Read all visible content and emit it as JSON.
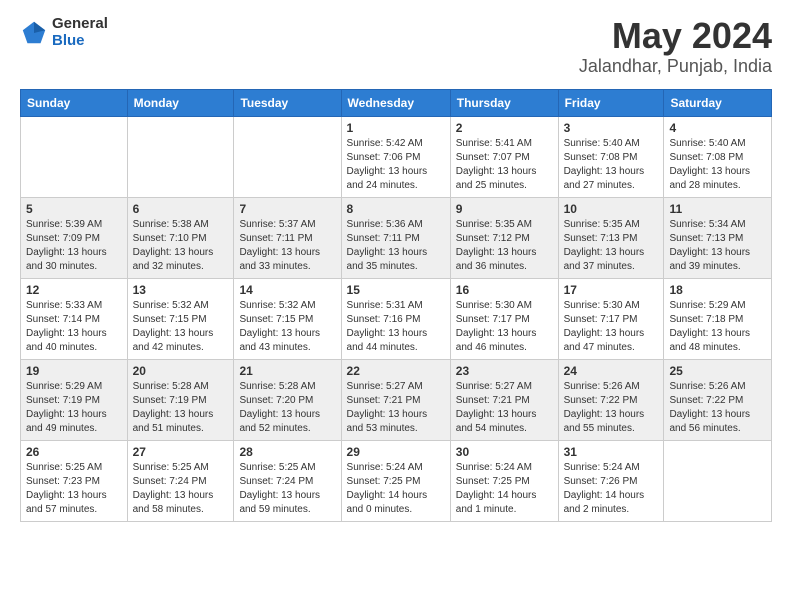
{
  "logo": {
    "general": "General",
    "blue": "Blue"
  },
  "title": "May 2024",
  "subtitle": "Jalandhar, Punjab, India",
  "days_of_week": [
    "Sunday",
    "Monday",
    "Tuesday",
    "Wednesday",
    "Thursday",
    "Friday",
    "Saturday"
  ],
  "weeks": [
    [
      {
        "day": "",
        "info": ""
      },
      {
        "day": "",
        "info": ""
      },
      {
        "day": "",
        "info": ""
      },
      {
        "day": "1",
        "info": "Sunrise: 5:42 AM\nSunset: 7:06 PM\nDaylight: 13 hours\nand 24 minutes."
      },
      {
        "day": "2",
        "info": "Sunrise: 5:41 AM\nSunset: 7:07 PM\nDaylight: 13 hours\nand 25 minutes."
      },
      {
        "day": "3",
        "info": "Sunrise: 5:40 AM\nSunset: 7:08 PM\nDaylight: 13 hours\nand 27 minutes."
      },
      {
        "day": "4",
        "info": "Sunrise: 5:40 AM\nSunset: 7:08 PM\nDaylight: 13 hours\nand 28 minutes."
      }
    ],
    [
      {
        "day": "5",
        "info": "Sunrise: 5:39 AM\nSunset: 7:09 PM\nDaylight: 13 hours\nand 30 minutes."
      },
      {
        "day": "6",
        "info": "Sunrise: 5:38 AM\nSunset: 7:10 PM\nDaylight: 13 hours\nand 32 minutes."
      },
      {
        "day": "7",
        "info": "Sunrise: 5:37 AM\nSunset: 7:11 PM\nDaylight: 13 hours\nand 33 minutes."
      },
      {
        "day": "8",
        "info": "Sunrise: 5:36 AM\nSunset: 7:11 PM\nDaylight: 13 hours\nand 35 minutes."
      },
      {
        "day": "9",
        "info": "Sunrise: 5:35 AM\nSunset: 7:12 PM\nDaylight: 13 hours\nand 36 minutes."
      },
      {
        "day": "10",
        "info": "Sunrise: 5:35 AM\nSunset: 7:13 PM\nDaylight: 13 hours\nand 37 minutes."
      },
      {
        "day": "11",
        "info": "Sunrise: 5:34 AM\nSunset: 7:13 PM\nDaylight: 13 hours\nand 39 minutes."
      }
    ],
    [
      {
        "day": "12",
        "info": "Sunrise: 5:33 AM\nSunset: 7:14 PM\nDaylight: 13 hours\nand 40 minutes."
      },
      {
        "day": "13",
        "info": "Sunrise: 5:32 AM\nSunset: 7:15 PM\nDaylight: 13 hours\nand 42 minutes."
      },
      {
        "day": "14",
        "info": "Sunrise: 5:32 AM\nSunset: 7:15 PM\nDaylight: 13 hours\nand 43 minutes."
      },
      {
        "day": "15",
        "info": "Sunrise: 5:31 AM\nSunset: 7:16 PM\nDaylight: 13 hours\nand 44 minutes."
      },
      {
        "day": "16",
        "info": "Sunrise: 5:30 AM\nSunset: 7:17 PM\nDaylight: 13 hours\nand 46 minutes."
      },
      {
        "day": "17",
        "info": "Sunrise: 5:30 AM\nSunset: 7:17 PM\nDaylight: 13 hours\nand 47 minutes."
      },
      {
        "day": "18",
        "info": "Sunrise: 5:29 AM\nSunset: 7:18 PM\nDaylight: 13 hours\nand 48 minutes."
      }
    ],
    [
      {
        "day": "19",
        "info": "Sunrise: 5:29 AM\nSunset: 7:19 PM\nDaylight: 13 hours\nand 49 minutes."
      },
      {
        "day": "20",
        "info": "Sunrise: 5:28 AM\nSunset: 7:19 PM\nDaylight: 13 hours\nand 51 minutes."
      },
      {
        "day": "21",
        "info": "Sunrise: 5:28 AM\nSunset: 7:20 PM\nDaylight: 13 hours\nand 52 minutes."
      },
      {
        "day": "22",
        "info": "Sunrise: 5:27 AM\nSunset: 7:21 PM\nDaylight: 13 hours\nand 53 minutes."
      },
      {
        "day": "23",
        "info": "Sunrise: 5:27 AM\nSunset: 7:21 PM\nDaylight: 13 hours\nand 54 minutes."
      },
      {
        "day": "24",
        "info": "Sunrise: 5:26 AM\nSunset: 7:22 PM\nDaylight: 13 hours\nand 55 minutes."
      },
      {
        "day": "25",
        "info": "Sunrise: 5:26 AM\nSunset: 7:22 PM\nDaylight: 13 hours\nand 56 minutes."
      }
    ],
    [
      {
        "day": "26",
        "info": "Sunrise: 5:25 AM\nSunset: 7:23 PM\nDaylight: 13 hours\nand 57 minutes."
      },
      {
        "day": "27",
        "info": "Sunrise: 5:25 AM\nSunset: 7:24 PM\nDaylight: 13 hours\nand 58 minutes."
      },
      {
        "day": "28",
        "info": "Sunrise: 5:25 AM\nSunset: 7:24 PM\nDaylight: 13 hours\nand 59 minutes."
      },
      {
        "day": "29",
        "info": "Sunrise: 5:24 AM\nSunset: 7:25 PM\nDaylight: 14 hours\nand 0 minutes."
      },
      {
        "day": "30",
        "info": "Sunrise: 5:24 AM\nSunset: 7:25 PM\nDaylight: 14 hours\nand 1 minute."
      },
      {
        "day": "31",
        "info": "Sunrise: 5:24 AM\nSunset: 7:26 PM\nDaylight: 14 hours\nand 2 minutes."
      },
      {
        "day": "",
        "info": ""
      }
    ]
  ]
}
